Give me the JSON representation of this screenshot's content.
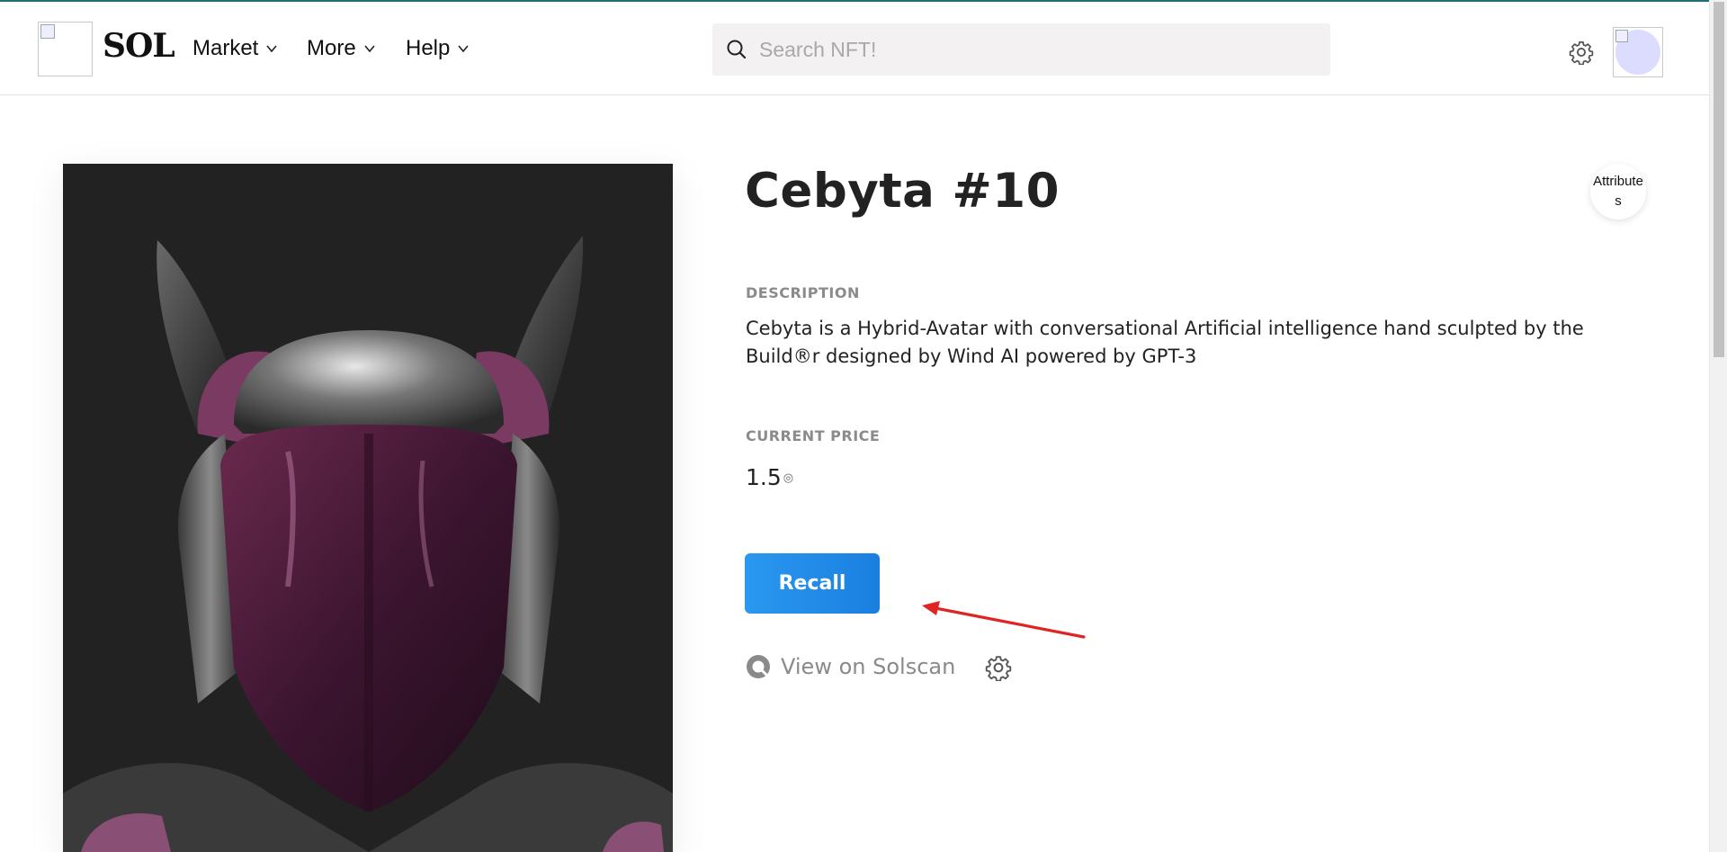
{
  "brand": {
    "name": "SOL"
  },
  "nav": {
    "market_label": "Market",
    "more_label": "More",
    "help_label": "Help"
  },
  "search": {
    "placeholder": "Search NFT!"
  },
  "nft": {
    "title": "Cebyta #10",
    "attributes_label": "Attributes",
    "description_label": "DESCRIPTION",
    "description": "Cebyta is a Hybrid-Avatar with conversational Artificial intelligence hand sculpted by the Build®r designed by Wind AI powered by GPT-3",
    "price_label": "CURRENT PRICE",
    "price_value": "1.5",
    "price_currency_symbol": "◎",
    "recall_label": "Recall",
    "solscan_label": "View on Solscan"
  },
  "colors": {
    "accent": "#1a7fe0",
    "topline": "#1f6f73",
    "arrow": "#e02424",
    "image_bg": "#222222"
  },
  "icons": {
    "search": "search-icon",
    "settings": "gear-icon",
    "chevron": "chevron-down-icon",
    "solscan": "solscan-icon"
  }
}
